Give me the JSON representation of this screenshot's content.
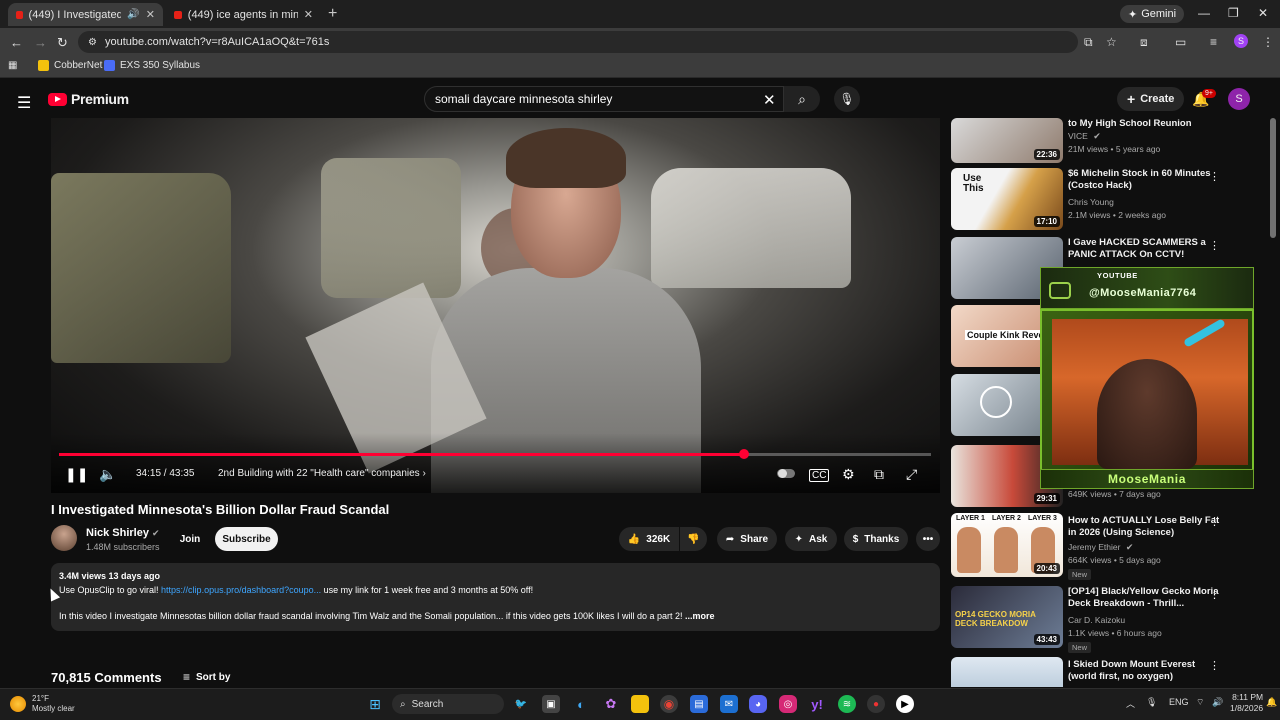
{
  "browser": {
    "tabs": [
      {
        "label": "(449) I Investigated Minnes..."
      },
      {
        "label": "(449) ice agents in minnesota -"
      }
    ],
    "new_tab": "+",
    "gemini_label": "Gemini",
    "url": "youtube.com/watch?v=r8AuICA1aOQ&t=761s",
    "bookmarks": [
      {
        "label": "CobberNet",
        "color": "#f4c20d"
      },
      {
        "label": "EXS 350 Syllabus",
        "color": "#4a6cf7"
      }
    ],
    "profile_initial": "S"
  },
  "youtube": {
    "logo_text": "Premium",
    "search_query": "somali daycare minnesota shirley",
    "create_label": "Create",
    "notif_badge": "9+",
    "avatar_initial": "S"
  },
  "player": {
    "time_current": "34:15",
    "time_total": "43:35",
    "time_display": "34:15 / 43:35",
    "chapter": "2nd Building with 22 \"Health care\" companies",
    "progress_fraction": 0.786
  },
  "video": {
    "title": "I Investigated Minnesota's Billion Dollar Fraud Scandal",
    "channel": "Nick Shirley",
    "subscribers": "1.48M subscribers",
    "join_label": "Join",
    "subscribe_label": "Subscribe",
    "likes": "326K",
    "share_label": "Share",
    "ask_label": "Ask",
    "thanks_label": "Thanks",
    "views_age": "3.4M views  13 days ago",
    "desc_line1_pre": "Use OpusClip to go viral! ",
    "desc_link": "https://clip.opus.pro/dashboard?coupo...",
    "desc_line1_post": " use my link for 1 week free and 3 months at 50% off!",
    "desc_line2": "In this video I investigate Minnesotas billion dollar fraud scandal involving Tim Walz and the Somali population... if this video gets 100K likes I will do a part 2!",
    "more_label": "...more",
    "comments_count": "70,815 Comments",
    "sort_label": "Sort by"
  },
  "recommendations": [
    {
      "title": "to My High School Reunion",
      "channel": "VICE",
      "views": "21M views • 5 years ago",
      "duration": "22:36"
    },
    {
      "title": "$6 Michelin Stock in 60 Minutes (Costco Hack)",
      "channel": "Chris Young",
      "views": "2.1M views • 2 weeks ago",
      "duration": "17:10",
      "thumb_text": "Use This"
    },
    {
      "title": "I Gave HACKED SCAMMERS a PANIC ATTACK On CCTV!",
      "channel": "",
      "views": "",
      "duration": ""
    },
    {
      "title": "",
      "channel": "",
      "views": "",
      "duration": "",
      "thumb_text": "Couple Kink Reve"
    },
    {
      "title": "",
      "channel": "",
      "views": "",
      "duration": ""
    },
    {
      "title": "",
      "channel": "",
      "views": "649K views • 7 days ago",
      "duration": "29:31"
    },
    {
      "title": "How to ACTUALLY Lose Belly Fat in 2026 (Using Science)",
      "channel": "Jeremy Ethier",
      "views": "664K views • 5 days ago",
      "duration": "20:43",
      "badge": "New",
      "layers": [
        "LAYER 1",
        "LAYER 2",
        "LAYER 3"
      ]
    },
    {
      "title": "[OP14] Black/Yellow Gecko Moria Deck Breakdown - Thrill...",
      "channel": "Car D. Kaizoku",
      "views": "1.1K views • 6 hours ago",
      "duration": "43:43",
      "badge": "New",
      "thumb_text": "OP14 GECKO MORIA DECK BREAKDOW"
    },
    {
      "title": "I Skied Down Mount Everest (world first, no oxygen)",
      "channel": "",
      "views": "",
      "duration": ""
    }
  ],
  "overlay": {
    "platform": "YOUTUBE",
    "handle": "@MooseMania7764",
    "name": "MooseMania"
  },
  "taskbar": {
    "temperature": "21°F",
    "weather": "Mostly clear",
    "search_label": "Search",
    "lang": "ENG",
    "time": "8:11 PM",
    "date": "1/8/2026"
  }
}
